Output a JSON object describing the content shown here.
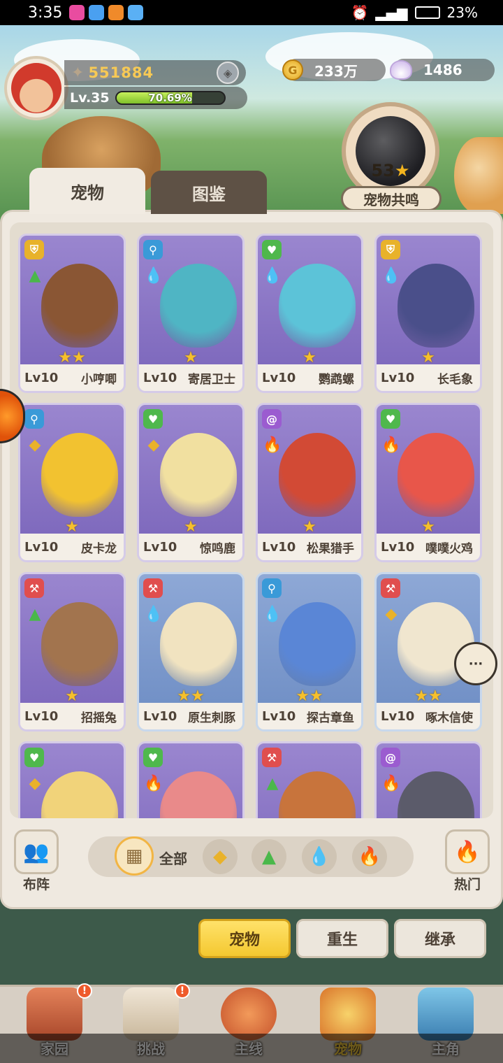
{
  "status_bar": {
    "time": "3:35",
    "battery": "23%"
  },
  "player": {
    "combat_power": "551884",
    "level": "Lv.35",
    "xp_percent_label": "70.69%",
    "xp_fraction": 0.7069
  },
  "currency": {
    "coins": "233万",
    "shells": "1486"
  },
  "resonance": {
    "count": "53",
    "label": "宠物共鸣"
  },
  "tabs": [
    {
      "label": "宠物",
      "active": true
    },
    {
      "label": "图鉴",
      "active": false
    }
  ],
  "pets": [
    {
      "level": "Lv10",
      "name": "小哼唧",
      "stars": "★★",
      "role": "shield",
      "element": "grass",
      "art": "violet",
      "creature_color": "#8a5634"
    },
    {
      "level": "Lv10",
      "name": "寄居卫士",
      "stars": "★",
      "role": "search",
      "element": "water",
      "art": "violet",
      "creature_color": "#4fb5c4"
    },
    {
      "level": "Lv10",
      "name": "鹦鹉螺",
      "stars": "★",
      "role": "heart",
      "element": "water",
      "art": "violet",
      "creature_color": "#5cc3d8"
    },
    {
      "level": "Lv10",
      "name": "长毛象",
      "stars": "★",
      "role": "shield",
      "element": "water",
      "art": "violet",
      "creature_color": "#4a4f8a"
    },
    {
      "level": "Lv10",
      "name": "皮卡龙",
      "stars": "★",
      "role": "search",
      "element": "rock",
      "art": "violet",
      "creature_color": "#f2c230"
    },
    {
      "level": "Lv10",
      "name": "惊鸣鹿",
      "stars": "★",
      "role": "heart",
      "element": "rock",
      "art": "violet",
      "creature_color": "#f1e0a0"
    },
    {
      "level": "Lv10",
      "name": "松果猎手",
      "stars": "★",
      "role": "spiral",
      "element": "fire",
      "art": "violet",
      "creature_color": "#d24a35"
    },
    {
      "level": "Lv10",
      "name": "噗噗火鸡",
      "stars": "★",
      "role": "heart",
      "element": "fire",
      "art": "violet",
      "creature_color": "#e8564a"
    },
    {
      "level": "Lv10",
      "name": "招摇兔",
      "stars": "★",
      "role": "axe",
      "element": "grass",
      "art": "violet",
      "creature_color": "#a2744e"
    },
    {
      "level": "Lv10",
      "name": "原生刺豚",
      "stars": "★★",
      "role": "axe",
      "element": "water",
      "art": "blue",
      "creature_color": "#f1e3c0"
    },
    {
      "level": "Lv10",
      "name": "探古章鱼",
      "stars": "★★",
      "role": "search",
      "element": "water",
      "art": "blue",
      "creature_color": "#5a86d6"
    },
    {
      "level": "Lv10",
      "name": "啄木信使",
      "stars": "★★",
      "role": "axe",
      "element": "rock",
      "art": "blue",
      "creature_color": "#f0e6cf"
    },
    {
      "level": "",
      "name": "",
      "stars": "",
      "role": "heart",
      "element": "rock",
      "art": "violet",
      "creature_color": "#f1d37a"
    },
    {
      "level": "",
      "name": "",
      "stars": "",
      "role": "heart",
      "element": "fire",
      "art": "violet",
      "creature_color": "#e98a8a"
    },
    {
      "level": "",
      "name": "",
      "stars": "",
      "role": "axe",
      "element": "grass",
      "art": "violet",
      "creature_color": "#c8743c"
    },
    {
      "level": "",
      "name": "",
      "stars": "",
      "role": "spiral",
      "element": "fire",
      "art": "violet",
      "creature_color": "#5b5b6a"
    }
  ],
  "filters": {
    "formation_label": "布阵",
    "all_label": "全部",
    "hot_label": "热门"
  },
  "actions": [
    {
      "label": "宠物",
      "active": true
    },
    {
      "label": "重生",
      "active": false
    },
    {
      "label": "继承",
      "active": false
    }
  ],
  "nav": [
    {
      "label": "家园",
      "active": false,
      "alert": true
    },
    {
      "label": "挑战",
      "active": false,
      "alert": true
    },
    {
      "label": "主线",
      "active": false,
      "alert": false
    },
    {
      "label": "宠物",
      "active": true,
      "alert": false
    },
    {
      "label": "主角",
      "active": false,
      "alert": false
    }
  ],
  "colors": {
    "accent_yellow": "#f4c830",
    "role_shield": "#e8b22a",
    "role_search": "#3a9ad8",
    "role_heart": "#4fb84c",
    "role_spiral": "#9b5cd0",
    "role_axe": "#e04e4e"
  }
}
